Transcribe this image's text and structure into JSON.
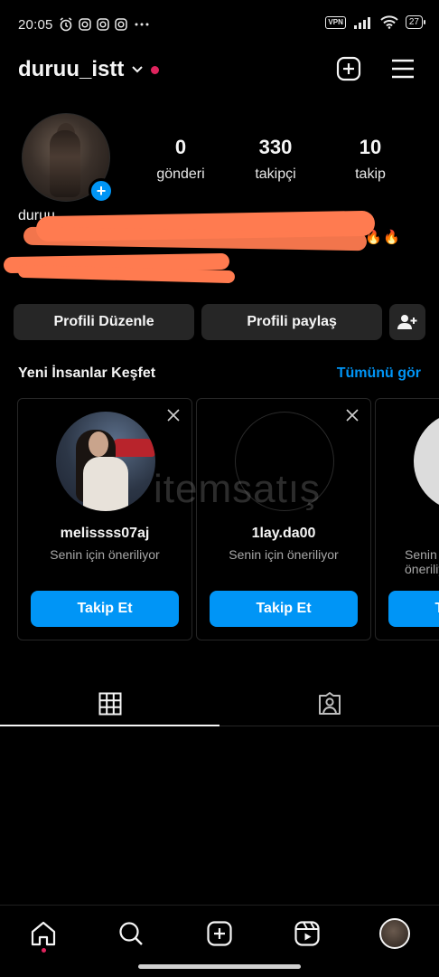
{
  "status_bar": {
    "time": "20:05",
    "vpn": "VPN",
    "battery": "27"
  },
  "header": {
    "username": "duruu_istt"
  },
  "profile": {
    "stats": [
      {
        "value": "0",
        "label": "gönderi"
      },
      {
        "value": "330",
        "label": "takipçi"
      },
      {
        "value": "10",
        "label": "takip"
      }
    ],
    "bio_name": "duruu"
  },
  "actions": {
    "edit_profile": "Profili Düzenle",
    "share_profile": "Profili paylaş"
  },
  "discover": {
    "title": "Yeni İnsanlar Keşfet",
    "see_all": "Tümünü gör",
    "cards": [
      {
        "username": "melissss07aj",
        "subtitle": "Senin için öneriliyor",
        "follow_label": "Takip Et"
      },
      {
        "username": "1lay.da00",
        "subtitle": "Senin için öneriliyor",
        "follow_label": "Takip Et"
      },
      {
        "username": "",
        "subtitle": "Senin için öneriliyor",
        "follow_label": "Takip Et"
      }
    ]
  },
  "watermark": "itemsatış",
  "colors": {
    "accent": "#0095f6",
    "notification": "#e0245e",
    "redaction": "#ff7b50",
    "button_bg": "#262626"
  }
}
